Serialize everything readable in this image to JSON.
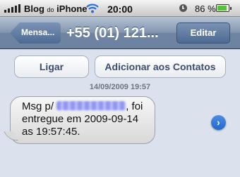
{
  "status_bar": {
    "carrier": "Blog",
    "carrier_sub": "do",
    "carrier_tail": "iPhone",
    "time": "20:00",
    "battery_text": "86 %",
    "battery_level": 0.86,
    "icons": [
      "signal-bars-icon",
      "wifi-icon",
      "rotation-lock-icon",
      "battery-icon"
    ]
  },
  "nav": {
    "back_label": "Mensa...",
    "title": "+55 (01) 121...",
    "edit_label": "Editar"
  },
  "actions": {
    "call_label": "Ligar",
    "add_contact_label": "Adicionar aos Contatos"
  },
  "conversation": {
    "timestamp": "14/09/2009 19:57",
    "message": {
      "prefix": "Msg p/",
      "suffix": ", foi",
      "line2": "entregue em 2009-09-14",
      "line3": "as 19:57:45."
    },
    "detail_icon": "chevron-right-icon"
  },
  "colors": {
    "nav_bar": "#6e84a2",
    "background": "#dbe2ed",
    "button_text": "#3a4e6e",
    "detail_button": "#2567c9",
    "battery_fill": "#56c13f"
  }
}
